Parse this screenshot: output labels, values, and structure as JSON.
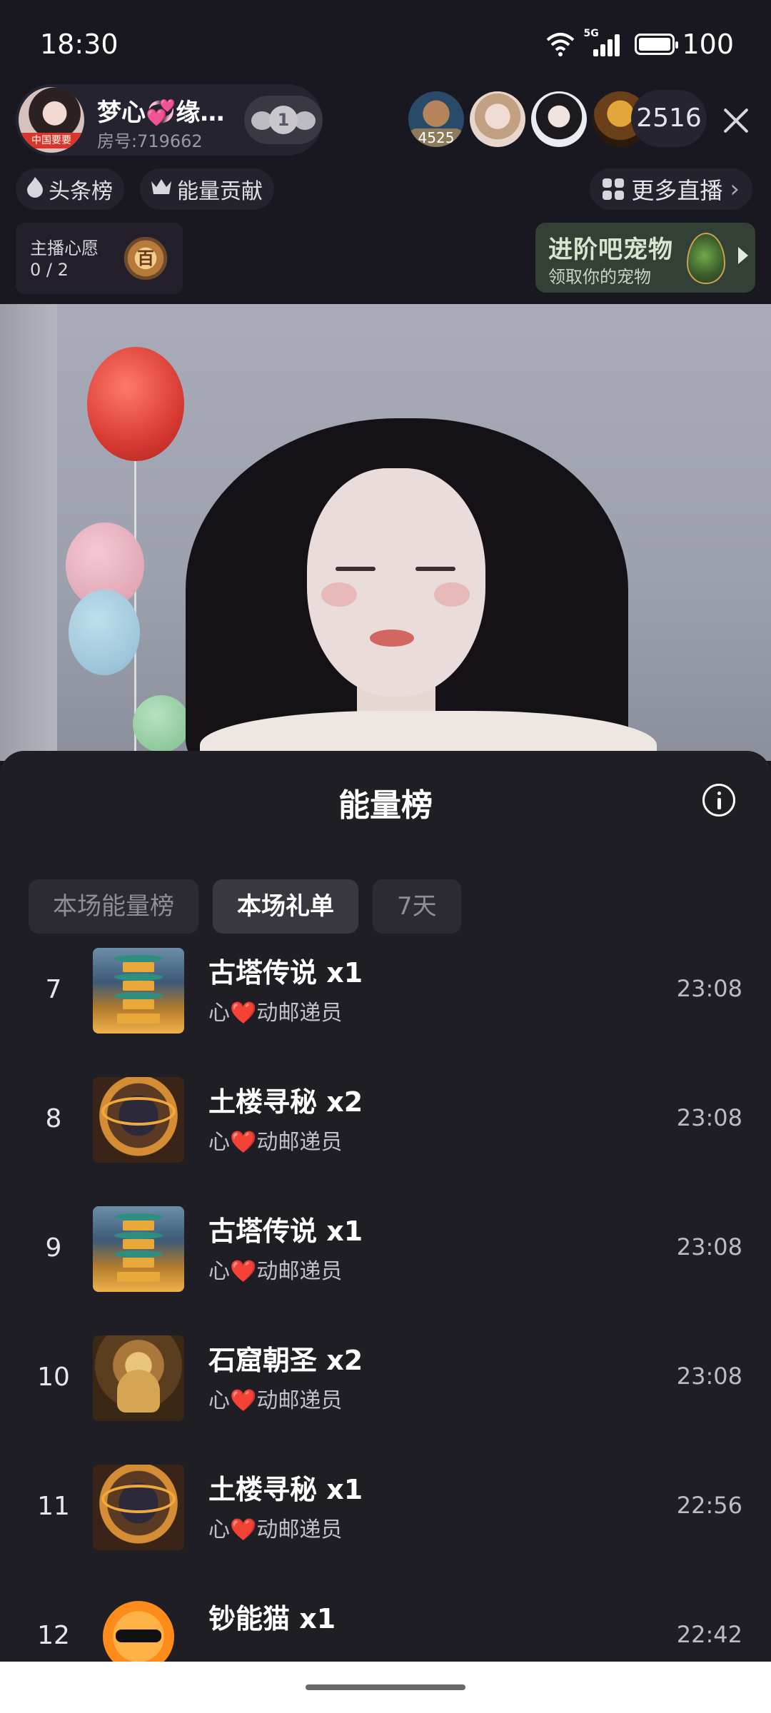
{
  "status": {
    "time": "18:30",
    "network": "5G",
    "battery": "100"
  },
  "host": {
    "name": "梦心💞缘…",
    "room": "房号:719662",
    "avatar_tag": "中国要要",
    "follow_level": "1"
  },
  "viewers": {
    "first_badge": "4525",
    "count": "2516"
  },
  "chips": {
    "headline": "头条榜",
    "energy": "能量贡献",
    "more_live": "更多直播"
  },
  "wish": {
    "title": "主播心愿",
    "progress": "0 / 2",
    "medal_label": "百"
  },
  "pet_promo": {
    "title": "进阶吧宠物",
    "subtitle": "领取你的宠物"
  },
  "sheet": {
    "title": "能量榜",
    "tabs": [
      {
        "label": "本场能量榜",
        "active": false
      },
      {
        "label": "本场礼单",
        "active": true
      },
      {
        "label": "7天",
        "active": false
      }
    ],
    "rows": [
      {
        "rank": "7",
        "gift": "古塔传说  x1",
        "sender_pre": "心",
        "sender_heart": "❤️",
        "sender_post": "动邮递员",
        "time": "23:08",
        "art": "tower"
      },
      {
        "rank": "8",
        "gift": "土楼寻秘  x2",
        "sender_pre": "心",
        "sender_heart": "❤️",
        "sender_post": "动邮递员",
        "time": "23:08",
        "art": "tulou"
      },
      {
        "rank": "9",
        "gift": "古塔传说  x1",
        "sender_pre": "心",
        "sender_heart": "❤️",
        "sender_post": "动邮递员",
        "time": "23:08",
        "art": "tower"
      },
      {
        "rank": "10",
        "gift": "石窟朝圣  x2",
        "sender_pre": "心",
        "sender_heart": "❤️",
        "sender_post": "动邮递员",
        "time": "23:08",
        "art": "buddha"
      },
      {
        "rank": "11",
        "gift": "土楼寻秘  x1",
        "sender_pre": "心",
        "sender_heart": "❤️",
        "sender_post": "动邮递员",
        "time": "22:56",
        "art": "tulou"
      },
      {
        "rank": "12",
        "gift": "钞能猫  x1",
        "sender_pre": "",
        "sender_heart": "",
        "sender_post": "",
        "time": "22:42",
        "art": "cat"
      }
    ]
  }
}
